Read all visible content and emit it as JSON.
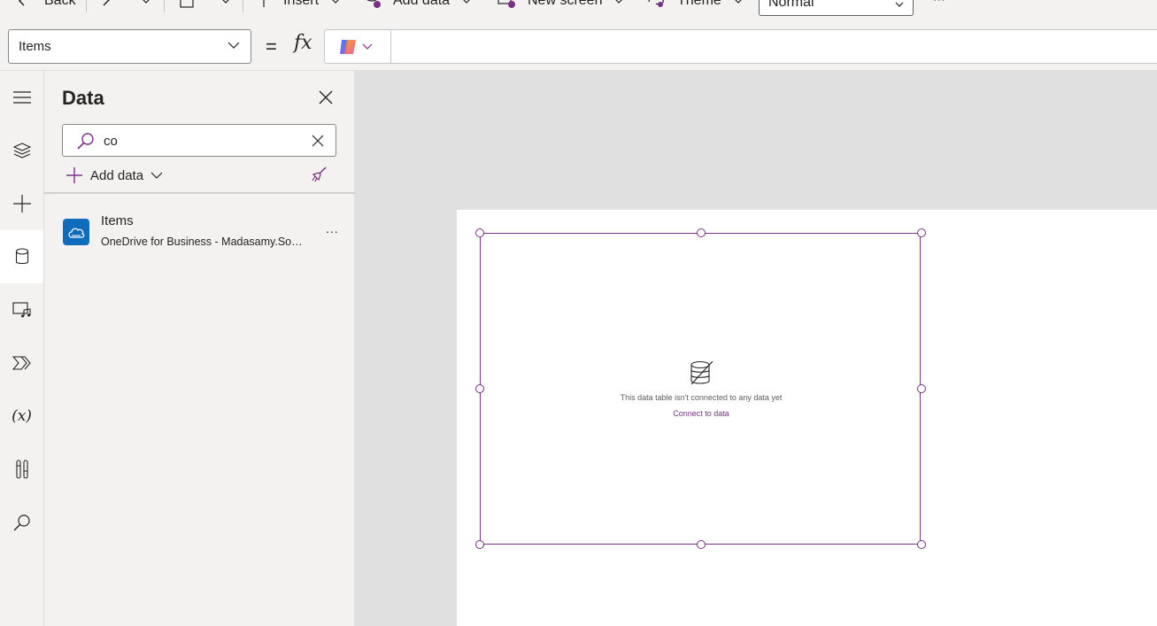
{
  "toolbar": {
    "back_label": "Back",
    "insert_label": "Insert",
    "add_data_label": "Add data",
    "new_screen_label": "New screen",
    "theme_label": "Theme",
    "theme_value": "Normal",
    "more_label": "..."
  },
  "formula_bar": {
    "property": "Items",
    "equals": "=",
    "fx": "fx"
  },
  "left_rail": {
    "items": [
      "menu-icon",
      "tree-view-icon",
      "insert-icon",
      "data-icon",
      "media-icon",
      "power-automate-icon",
      "variables-icon",
      "advanced-tools-icon",
      "search-icon"
    ],
    "active": "data-icon"
  },
  "data_pane": {
    "title": "Data",
    "search_value": "co",
    "add_data_label": "Add data",
    "datasources": [
      {
        "name": "Items",
        "subtitle": "OneDrive for Business - Madasamy.Sollaiappan@...",
        "more": "..."
      }
    ]
  },
  "canvas": {
    "empty_message": "This data table isn't connected to any data yet",
    "connect_link": "Connect to data"
  },
  "colors": {
    "accent": "#7a2f88",
    "onedrive_blue": "#0f6cbd",
    "canvas_bg": "#e0e0e0",
    "pane_bg": "#f3f2f1"
  }
}
